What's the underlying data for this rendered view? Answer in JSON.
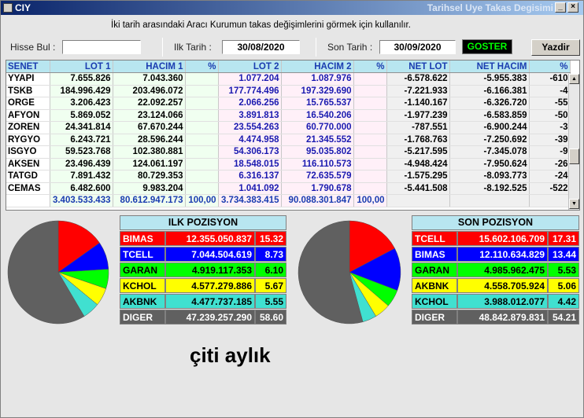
{
  "window": {
    "app_name": "CIY",
    "title": "Tarihsel Uye Takas Degisimi",
    "minimize": "_",
    "close": "×"
  },
  "info_text": "İki tarih arasındaki  Aracı Kurumun takas değişimlerini görmek için kullanılır.",
  "controls": {
    "hisse_label": "Hisse Bul :",
    "hisse_value": "",
    "ilk_label": "Ilk Tarih :",
    "ilk_value": "30/08/2020",
    "son_label": "Son Tarih :",
    "son_value": "30/09/2020",
    "goster": "GOSTER",
    "yazdir": "Yazdir"
  },
  "table": {
    "headers": [
      "SENET",
      "LOT 1",
      "HACIM 1",
      "%",
      "LOT 2",
      "HACIM 2",
      "%",
      "NET LOT",
      "NET HACIM",
      "%"
    ],
    "rows": [
      [
        "YYAPI",
        "7.655.826",
        "7.043.360",
        "",
        "1.077.204",
        "1.087.976",
        "",
        "-6.578.622",
        "-5.955.383",
        "-610"
      ],
      [
        "TSKB",
        "184.996.429",
        "203.496.072",
        "",
        "177.774.496",
        "197.329.690",
        "",
        "-7.221.933",
        "-6.166.381",
        "-4"
      ],
      [
        "ORGE",
        "3.206.423",
        "22.092.257",
        "",
        "2.066.256",
        "15.765.537",
        "",
        "-1.140.167",
        "-6.326.720",
        "-55"
      ],
      [
        "AFYON",
        "5.869.052",
        "23.124.066",
        "",
        "3.891.813",
        "16.540.206",
        "",
        "-1.977.239",
        "-6.583.859",
        "-50"
      ],
      [
        "ZOREN",
        "24.341.814",
        "67.670.244",
        "",
        "23.554.263",
        "60.770.000",
        "",
        "-787.551",
        "-6.900.244",
        "-3"
      ],
      [
        "RYGYO",
        "6.243.721",
        "28.596.244",
        "",
        "4.474.958",
        "21.345.552",
        "",
        "-1.768.763",
        "-7.250.692",
        "-39"
      ],
      [
        "ISGYO",
        "59.523.768",
        "102.380.881",
        "",
        "54.306.173",
        "95.035.802",
        "",
        "-5.217.595",
        "-7.345.078",
        "-9"
      ],
      [
        "AKSEN",
        "23.496.439",
        "124.061.197",
        "",
        "18.548.015",
        "116.110.573",
        "",
        "-4.948.424",
        "-7.950.624",
        "-26"
      ],
      [
        "TATGD",
        "7.891.432",
        "80.729.353",
        "",
        "6.316.137",
        "72.635.579",
        "",
        "-1.575.295",
        "-8.093.773",
        "-24"
      ],
      [
        "CEMAS",
        "6.482.600",
        "9.983.204",
        "",
        "1.041.092",
        "1.790.678",
        "",
        "-5.441.508",
        "-8.192.525",
        "-522"
      ]
    ],
    "totals": [
      "",
      "3.403.533.433",
      "80.612.947.173",
      "100,00",
      "3.734.383.415",
      "90.088.301.847",
      "100,00",
      "",
      "",
      ""
    ]
  },
  "ilk": {
    "title": "ILK POZISYON",
    "rows": [
      {
        "name": "BIMAS",
        "value": "12.355.050.837",
        "pct": "15.32",
        "share": 15.32,
        "color": "#ff0000",
        "text": "#ffffff"
      },
      {
        "name": "TCELL",
        "value": "7.044.504.619",
        "pct": "8.73",
        "share": 8.73,
        "color": "#0000ff",
        "text": "#ffffff"
      },
      {
        "name": "GARAN",
        "value": "4.919.117.353",
        "pct": "6.10",
        "share": 6.1,
        "color": "#00ff00",
        "text": "#000000"
      },
      {
        "name": "KCHOL",
        "value": "4.577.279.886",
        "pct": "5.67",
        "share": 5.67,
        "color": "#ffff00",
        "text": "#000000"
      },
      {
        "name": "AKBNK",
        "value": "4.477.737.185",
        "pct": "5.55",
        "share": 5.55,
        "color": "#40e0d0",
        "text": "#000000"
      },
      {
        "name": "DIGER",
        "value": "47.239.257.290",
        "pct": "58.60",
        "share": 58.6,
        "color": "#606060",
        "text": "#ffffff"
      }
    ]
  },
  "son": {
    "title": "SON POZISYON",
    "rows": [
      {
        "name": "TCELL",
        "value": "15.602.106.709",
        "pct": "17.31",
        "share": 17.31,
        "color": "#ff0000",
        "text": "#ffffff"
      },
      {
        "name": "BIMAS",
        "value": "12.110.634.829",
        "pct": "13.44",
        "share": 13.44,
        "color": "#0000ff",
        "text": "#ffffff"
      },
      {
        "name": "GARAN",
        "value": "4.985.962.475",
        "pct": "5.53",
        "share": 5.53,
        "color": "#00ff00",
        "text": "#000000"
      },
      {
        "name": "AKBNK",
        "value": "4.558.705.924",
        "pct": "5.06",
        "share": 5.06,
        "color": "#ffff00",
        "text": "#000000"
      },
      {
        "name": "KCHOL",
        "value": "3.988.012.077",
        "pct": "4.42",
        "share": 4.42,
        "color": "#40e0d0",
        "text": "#000000"
      },
      {
        "name": "DIGER",
        "value": "48.842.879.831",
        "pct": "54.21",
        "share": 54.21,
        "color": "#606060",
        "text": "#ffffff"
      }
    ]
  },
  "caption": "çiti aylık"
}
